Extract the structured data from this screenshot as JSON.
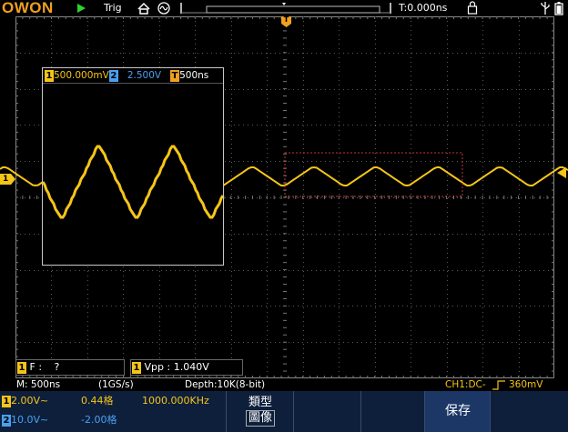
{
  "topbar": {
    "brand": "OWON",
    "run_state": "play-icon",
    "trigger_status": "Trig",
    "time_offset": "T:0.000ns"
  },
  "colors": {
    "ch1": "#f5c518",
    "ch2": "#4aa0f0",
    "trigger": "#f0a020",
    "accent": "#f0a020",
    "menu_bg": "#0e1f3c"
  },
  "zoom_window": {
    "ch1_scale": "500.000mV",
    "ch2_scale": "2.500V",
    "ch1_num": "1",
    "ch2_num": "2",
    "time_label": "T",
    "time_scale": "500ns"
  },
  "markers": {
    "ch1": "1",
    "trigger_top": "T"
  },
  "measurements": [
    {
      "channel": "1",
      "label": "F :",
      "value": "?"
    },
    {
      "channel": "1",
      "label": "Vpp :",
      "value": "1.040V"
    }
  ],
  "status": {
    "timebase": "M: 500ns",
    "sample_rate": "(1GS/s)",
    "depth": "Depth:10K(8-bit)",
    "trigger": "CH1:DC-",
    "trigger_level": "360mV"
  },
  "channels": [
    {
      "num": "1",
      "scale": "2.00V~",
      "offset": "0.44格",
      "freq": "1000.000KHz"
    },
    {
      "num": "2",
      "scale": "10.0V~",
      "offset": "-2.00格",
      "freq": ""
    }
  ],
  "menu": {
    "type_label": "類型",
    "type_value": "圖像",
    "save_label": "保存"
  }
}
